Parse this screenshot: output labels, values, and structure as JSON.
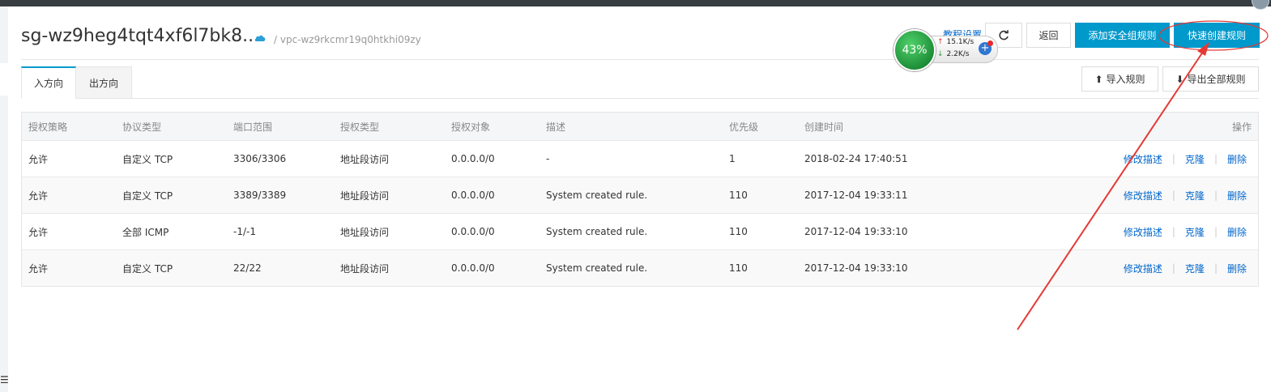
{
  "header": {
    "title": "sg-wz9heg4tqt4xf6l7bk8...",
    "vpc": "/ vpc-wz9rkcmr19q0htkhi09zy",
    "teach_link": "教程设置",
    "refresh_icon": "refresh-icon",
    "back_label": "返回",
    "add_rule_label": "添加安全组规则",
    "quick_create_label": "快速创建规则"
  },
  "tabs": [
    {
      "label": "入方向",
      "active": true
    },
    {
      "label": "出方向",
      "active": false
    }
  ],
  "actions": {
    "import_label": "导入规则",
    "export_label": "导出全部规则"
  },
  "table": {
    "headers": [
      "授权策略",
      "协议类型",
      "端口范围",
      "授权类型",
      "授权对象",
      "描述",
      "优先级",
      "创建时间",
      "操作"
    ],
    "rows": [
      {
        "policy": "允许",
        "protocol": "自定义 TCP",
        "port": "3306/3306",
        "auth_type": "地址段访问",
        "target": "0.0.0.0/0",
        "desc": "-",
        "priority": "1",
        "created": "2018-02-24 17:40:51"
      },
      {
        "policy": "允许",
        "protocol": "自定义 TCP",
        "port": "3389/3389",
        "auth_type": "地址段访问",
        "target": "0.0.0.0/0",
        "desc": "System created rule.",
        "priority": "110",
        "created": "2017-12-04 19:33:11"
      },
      {
        "policy": "允许",
        "protocol": "全部 ICMP",
        "port": "-1/-1",
        "auth_type": "地址段访问",
        "target": "0.0.0.0/0",
        "desc": "System created rule.",
        "priority": "110",
        "created": "2017-12-04 19:33:10"
      },
      {
        "policy": "允许",
        "protocol": "自定义 TCP",
        "port": "22/22",
        "auth_type": "地址段访问",
        "target": "0.0.0.0/0",
        "desc": "System created rule.",
        "priority": "110",
        "created": "2017-12-04 19:33:10"
      }
    ],
    "ops": {
      "edit": "修改描述",
      "clone": "克隆",
      "delete": "删除"
    }
  },
  "speed_widget": {
    "percent": "43%",
    "up": "15.1K/s",
    "down": "2.2K/s"
  },
  "colors": {
    "primary": "#0099cc",
    "link": "#0066cc",
    "annotation": "#e53935"
  }
}
